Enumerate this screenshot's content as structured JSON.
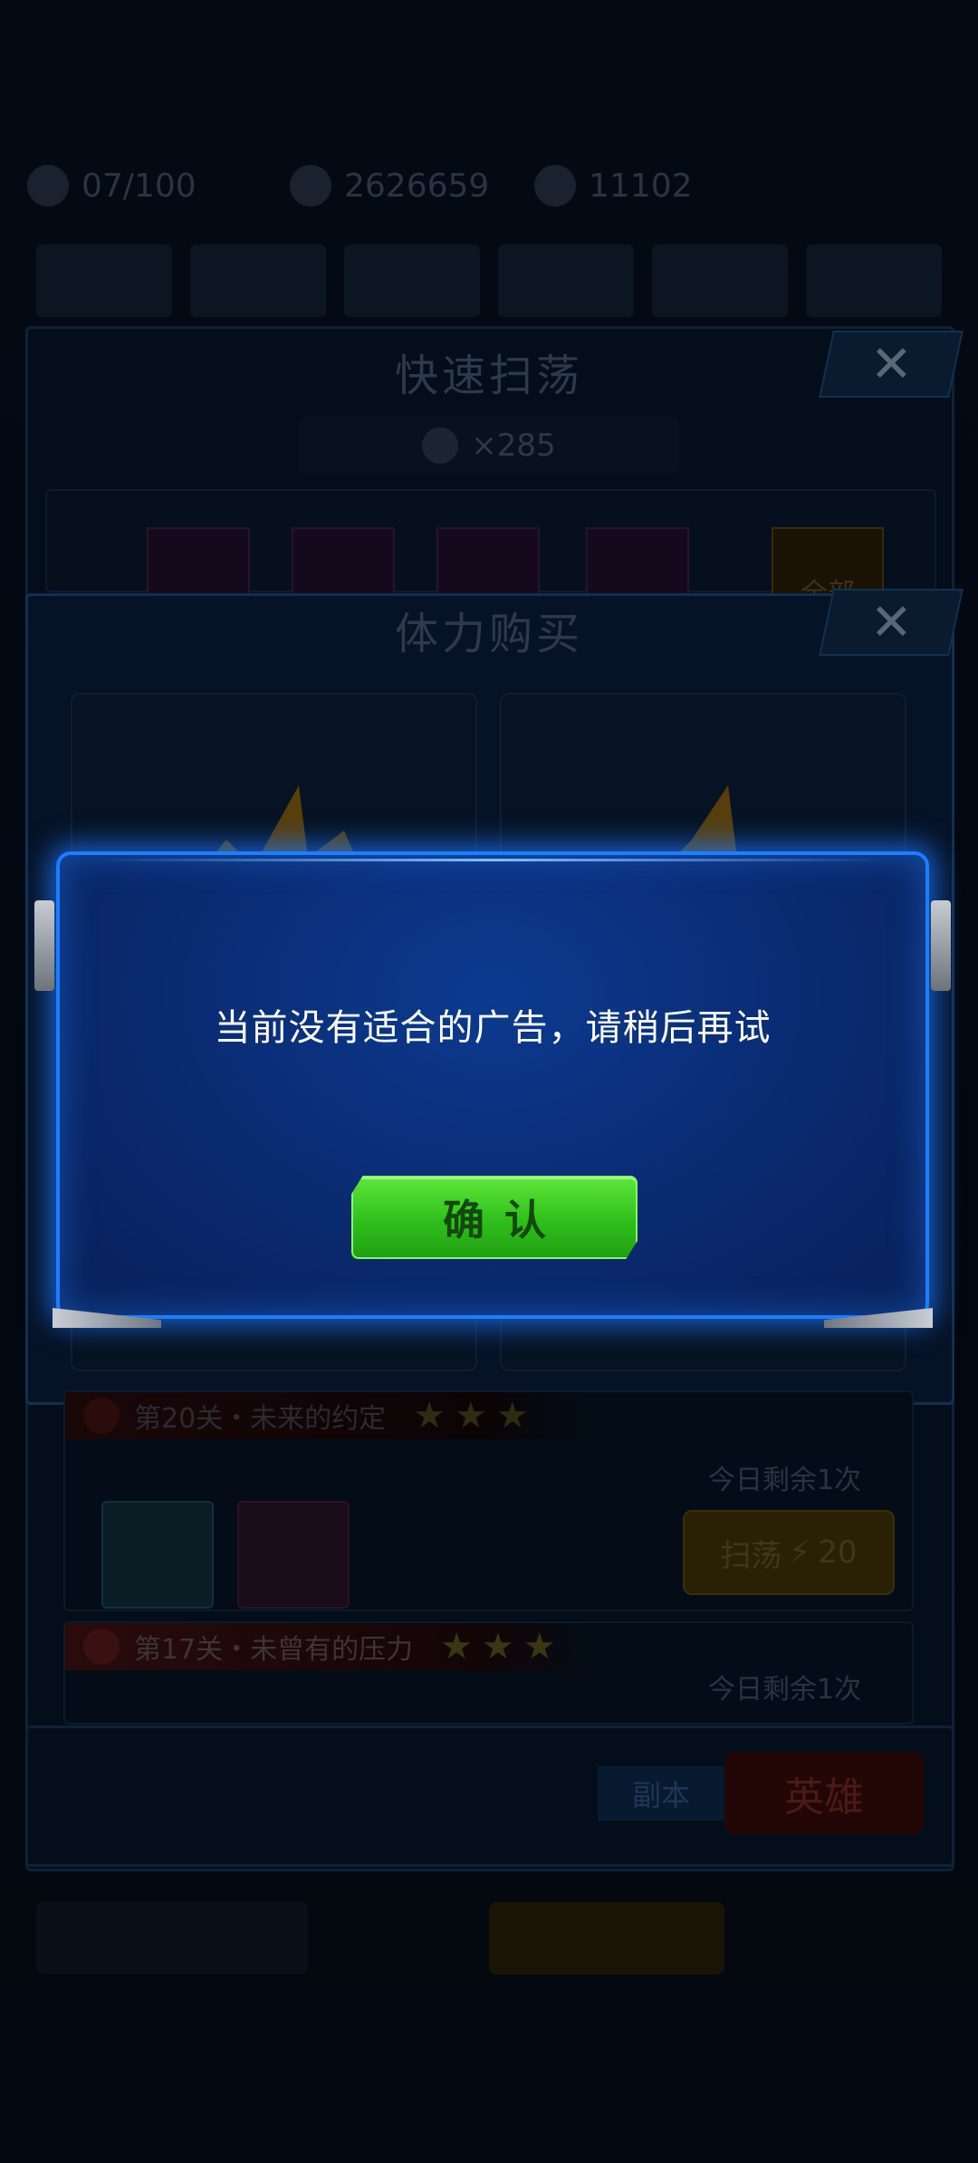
{
  "background": {
    "resources": [
      {
        "icon": "stamina-icon",
        "value": "07/100"
      },
      {
        "icon": "gold-icon",
        "value": "2626659"
      },
      {
        "icon": "diamond-icon",
        "value": "11102"
      }
    ],
    "sweep_panel": {
      "title": "快速扫荡",
      "close_label": "✕",
      "ticket_count": "×285",
      "all_label": "全部"
    },
    "stamina_panel": {
      "title": "体力购买",
      "close_label": "✕"
    },
    "stages": [
      {
        "title": "第20关・未来的约定",
        "remaining": "今日剩余1次",
        "sweep_label": "扫荡",
        "cost": "20"
      },
      {
        "title": "第17关・未曾有的压力",
        "remaining": "今日剩余1次"
      }
    ],
    "badges": {
      "ad": "副本",
      "hero": "英雄"
    }
  },
  "modal": {
    "message": "当前没有适合的广告，请稍后再试",
    "confirm_label": "确认"
  },
  "colors": {
    "modal_border": "#1f7dff",
    "modal_fill": "#0a2a70",
    "confirm_green": "#2fbf1c"
  }
}
